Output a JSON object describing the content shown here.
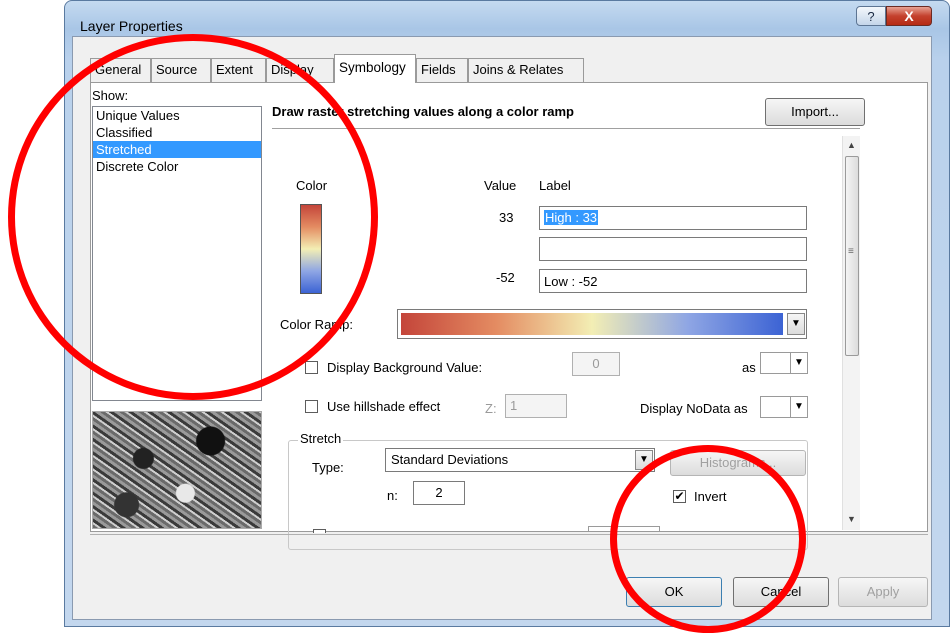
{
  "window": {
    "title": "Layer Properties",
    "help_button": "?",
    "close_button": "X"
  },
  "tabs": [
    {
      "label": "General"
    },
    {
      "label": "Source"
    },
    {
      "label": "Extent"
    },
    {
      "label": "Display"
    },
    {
      "label": "Symbology"
    },
    {
      "label": "Fields"
    },
    {
      "label": "Joins & Relates"
    }
  ],
  "show_panel": {
    "label": "Show:",
    "items": [
      "Unique Values",
      "Classified",
      "Stretched",
      "Discrete Color"
    ],
    "selected": "Stretched"
  },
  "symbology": {
    "description": "Draw raster stretching values along a color ramp",
    "import_button": "Import...",
    "color_header": "Color",
    "value_header": "Value",
    "label_header": "Label",
    "high_value": "33",
    "high_label": "High : 33",
    "mid_label": "",
    "low_value": "-52",
    "low_label": "Low : -52",
    "color_ramp_label": "Color Ramp:",
    "display_background_label": "Display Background Value:",
    "background_value": "0",
    "as_label": "as",
    "hillshade_label": "Use hillshade effect",
    "z_label": "Z:",
    "z_value": "1",
    "nodata_label": "Display NoData as",
    "stretch_group": "Stretch",
    "type_label": "Type:",
    "type_value": "Standard Deviations",
    "histograms_button": "Histograms...",
    "n_label": "n:",
    "n_value": "2",
    "invert_label": "Invert",
    "invert_checked": true,
    "display_background_checked": false,
    "hillshade_checked": false
  },
  "footer": {
    "ok": "OK",
    "cancel": "Cancel",
    "apply": "Apply"
  },
  "colors": {
    "ramp_high": "#c4453a",
    "ramp_mid": "#f3eeb4",
    "ramp_low": "#3c63d4",
    "selection": "#3399ff",
    "annotation": "#ff0000"
  }
}
